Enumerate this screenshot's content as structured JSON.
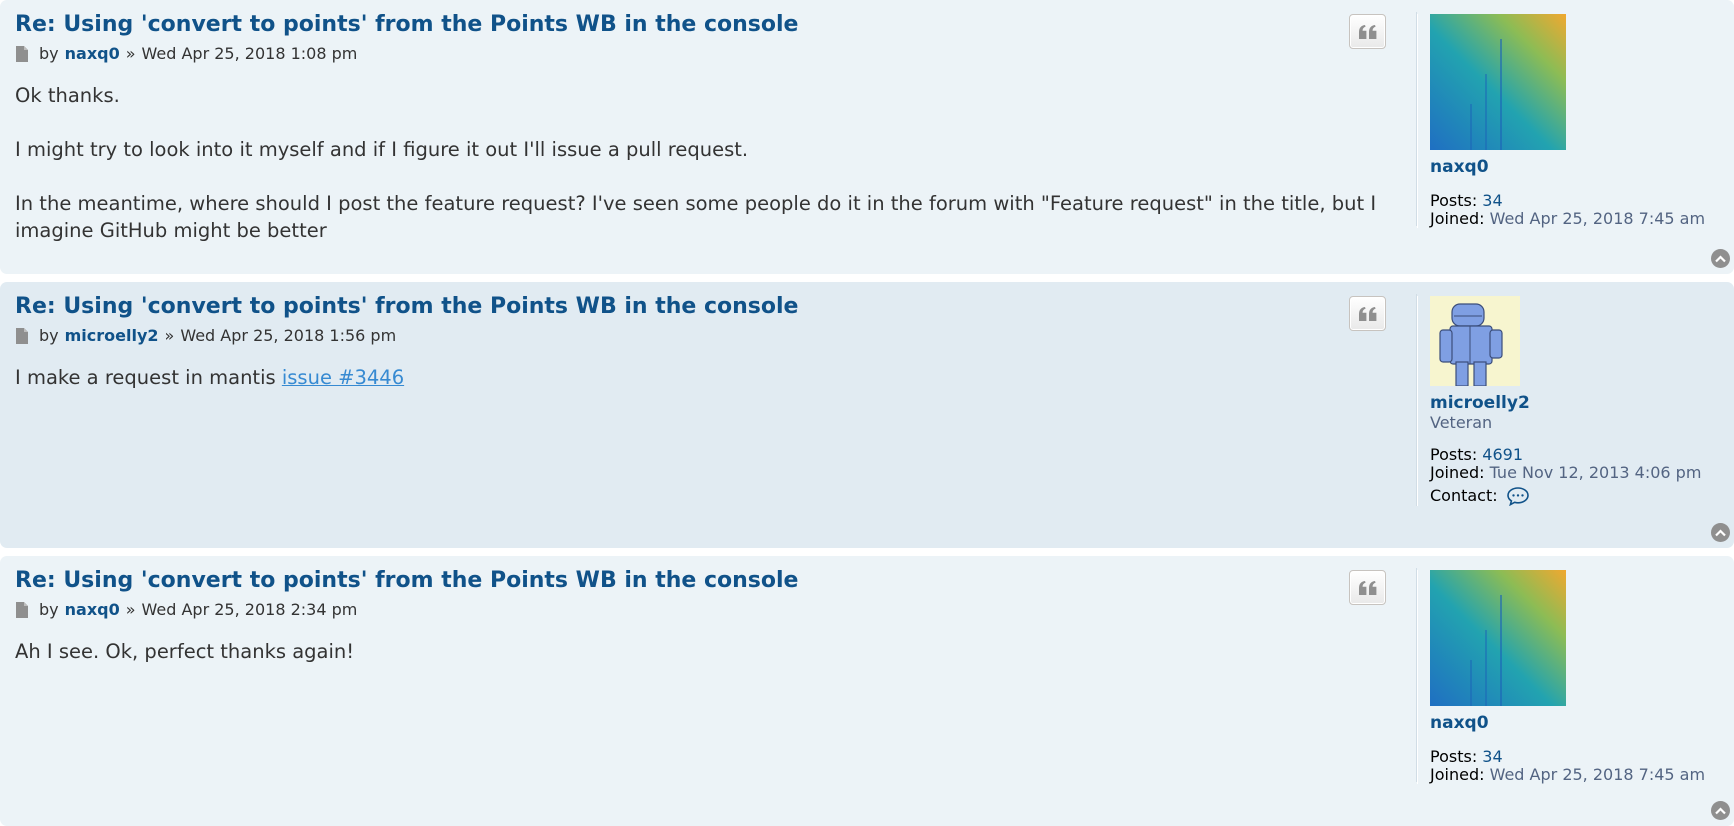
{
  "posts": [
    {
      "title": "Re: Using 'convert to points' from the Points WB in the console",
      "by": "by",
      "author": "naxq0",
      "sep": "»",
      "date": "Wed Apr 25, 2018 1:08 pm",
      "paragraphs": [
        "Ok thanks.",
        "I might try to look into it myself and if I figure it out I'll issue a pull request.",
        "In the meantime, where should I post the feature request? I've seen some people do it in the forum with \"Feature request\" in the title, but I imagine GitHub might be better"
      ],
      "profile": {
        "name": "naxq0",
        "posts_label": "Posts:",
        "posts": "34",
        "joined_label": "Joined:",
        "joined": "Wed Apr 25, 2018 7:45 am"
      }
    },
    {
      "title": "Re: Using 'convert to points' from the Points WB in the console",
      "by": "by",
      "author": "microelly2",
      "sep": "»",
      "date": "Wed Apr 25, 2018 1:56 pm",
      "text_prefix": "I make a request in mantis ",
      "link": "issue #3446",
      "profile": {
        "name": "microelly2",
        "rank": "Veteran",
        "posts_label": "Posts:",
        "posts": "4691",
        "joined_label": "Joined:",
        "joined": "Tue Nov 12, 2013 4:06 pm",
        "contact_label": "Contact:"
      }
    },
    {
      "title": "Re: Using 'convert to points' from the Points WB in the console",
      "by": "by",
      "author": "naxq0",
      "sep": "»",
      "date": "Wed Apr 25, 2018 2:34 pm",
      "paragraphs": [
        "Ah I see. Ok, perfect thanks again!"
      ],
      "profile": {
        "name": "naxq0",
        "posts_label": "Posts:",
        "posts": "34",
        "joined_label": "Joined:",
        "joined": "Wed Apr 25, 2018 7:45 am"
      }
    }
  ],
  "icons": {
    "post": "post-file-icon",
    "quote": "quote-icon",
    "contact": "contact-chat-icon",
    "top": "back-to-top-icon"
  },
  "colors": {
    "link": "#105289",
    "bg1": "#ecf3f7",
    "bg2": "#e1ebf2"
  }
}
